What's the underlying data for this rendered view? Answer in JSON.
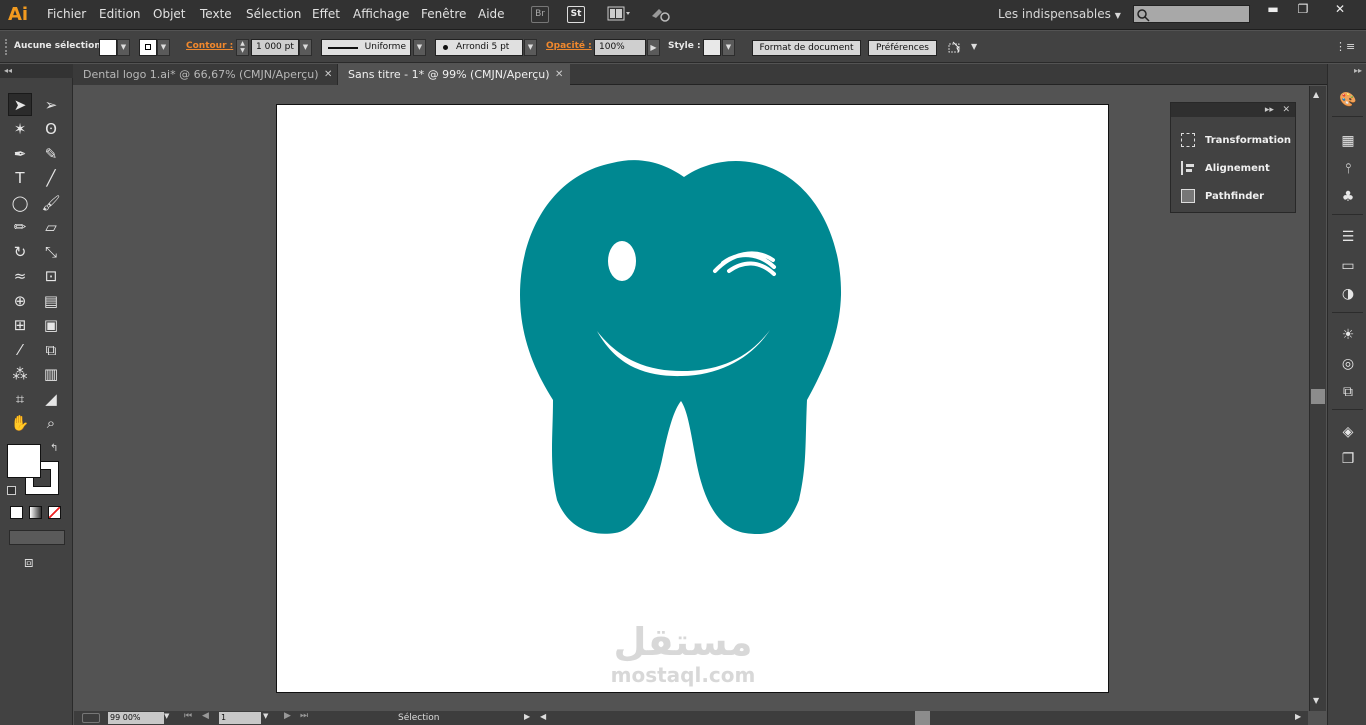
{
  "app": {
    "logo": "Ai"
  },
  "menu": [
    "Fichier",
    "Edition",
    "Objet",
    "Texte",
    "Sélection",
    "Effet",
    "Affichage",
    "Fenêtre",
    "Aide"
  ],
  "menubar_icons": {
    "br": "Br",
    "st": "St"
  },
  "workspace": "Les indispensables",
  "control": {
    "selection_label": "Aucune sélection",
    "stroke_label": "Contour :",
    "stroke_weight": "1 000 pt",
    "stroke_profile": "Uniforme",
    "brush": "Arrondi 5 pt",
    "opacity_label": "Opacité :",
    "opacity_value": "100%",
    "style_label": "Style :",
    "doc_format_button": "Format de document",
    "preferences_button": "Préférences"
  },
  "tabs": [
    {
      "label": "Dental logo 1.ai* @ 66,67% (CMJN/Aperçu)",
      "active": false
    },
    {
      "label": "Sans titre - 1* @ 99% (CMJN/Aperçu)",
      "active": true
    }
  ],
  "float_panel": {
    "items": [
      "Transformation",
      "Alignement",
      "Pathfinder"
    ]
  },
  "status": {
    "zoom": "99 00%",
    "page": "1",
    "tool": "Sélection"
  },
  "artwork": {
    "tooth_color": "#008891",
    "artboard_color": "#ffffff"
  },
  "watermark": {
    "arabic": "مستقل",
    "latin": "mostaql.com"
  },
  "icons": [
    "selection-tool-icon",
    "direct-selection-tool-icon",
    "magic-wand-icon",
    "lasso-icon",
    "pen-tool-icon",
    "curvature-icon",
    "type-tool-icon",
    "line-tool-icon",
    "ellipse-tool-icon",
    "paintbrush-icon",
    "pencil-icon",
    "eraser-icon",
    "rotate-icon",
    "scale-icon",
    "warp-icon",
    "free-transform-icon",
    "shape-builder-icon",
    "perspective-grid-icon",
    "mesh-icon",
    "gradient-icon",
    "eyedropper-icon",
    "blend-icon",
    "symbol-sprayer-icon",
    "column-graph-icon",
    "artboard-tool-icon",
    "slice-icon",
    "hand-icon",
    "zoom-icon"
  ]
}
